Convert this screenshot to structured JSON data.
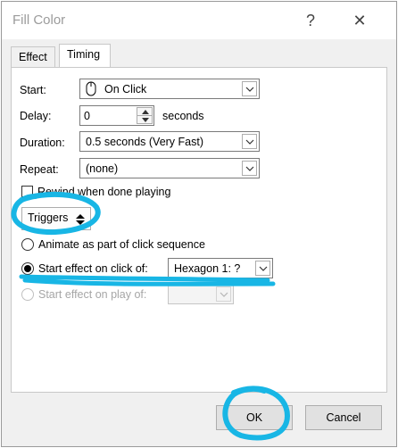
{
  "window": {
    "title": "Fill Color",
    "help_glyph": "?",
    "close_glyph": "✕"
  },
  "tabs": [
    {
      "label": "Effect"
    },
    {
      "label": "Timing"
    }
  ],
  "timing": {
    "start_label": "Start:",
    "start_value": "On Click",
    "start_icon": "mouse-icon",
    "delay_label": "Delay:",
    "delay_value": "0",
    "delay_unit": "seconds",
    "duration_label": "Duration:",
    "duration_value": "0.5 seconds (Very Fast)",
    "repeat_label": "Repeat:",
    "repeat_value": "(none)",
    "rewind_label": "Rewind when done playing"
  },
  "triggers": {
    "button_label": "Triggers",
    "option_animate": "Animate as part of click sequence",
    "option_click": "Start effect on click of:",
    "click_target": "Hexagon 1: ?",
    "option_play": "Start effect on play of:",
    "play_target": ""
  },
  "footer": {
    "ok_label": "OK",
    "cancel_label": "Cancel"
  },
  "annotation_color": "#18b6e5"
}
